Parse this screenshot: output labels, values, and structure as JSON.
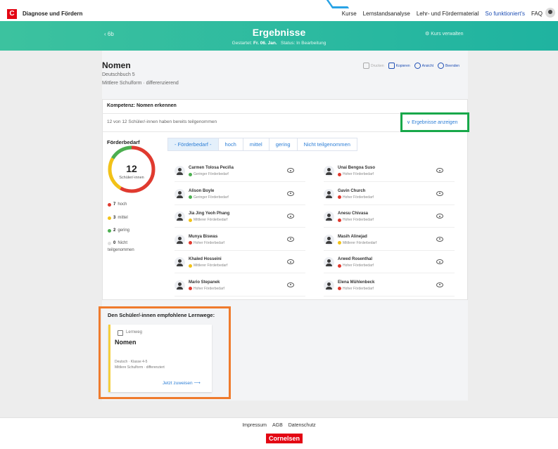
{
  "app": {
    "logo_letter": "C",
    "brand": "Diagnose und Fördern",
    "nav": [
      "Kurse",
      "Lernstandsanalyse",
      "Lehr- und Fördermaterial",
      "So funktioniert's",
      "FAQ"
    ]
  },
  "hero": {
    "back": "6b",
    "title": "Ergebnisse",
    "started_label": "Gestartet:",
    "started_value": "Fr. 06. Jan.",
    "status": "Status: In Bearbeitung",
    "manage": "Kurs verwalten"
  },
  "test": {
    "title": "Nomen",
    "book": "Deutschbuch 5",
    "school": "Mittlere Schulform · differenzierend",
    "actions": [
      "Drucken",
      "Kopieren",
      "Ansicht",
      "Beenden"
    ]
  },
  "competence": {
    "title": "Kompetenz: Nomen erkennen",
    "participation": "12 von 12 Schüler/-innen haben bereits teilgenommen",
    "toggle": "Ergebnisse anzeigen"
  },
  "foerder": {
    "title": "Förderbedarf",
    "count": "12",
    "count_label": "Schüler/-innen",
    "legend": [
      {
        "num": "7",
        "label": "hoch",
        "color": "#e03a2f"
      },
      {
        "num": "3",
        "label": "mittel",
        "color": "#f2c218"
      },
      {
        "num": "2",
        "label": "gering",
        "color": "#4caf50"
      },
      {
        "num": "0",
        "label": "Nicht",
        "label2": "teilgenommen",
        "color": "#e0e0e0"
      }
    ],
    "tabs": [
      "- Förderbedarf -",
      "hoch",
      "mittel",
      "gering",
      "Nicht teilgenommen"
    ]
  },
  "students_left": [
    {
      "name": "Carmen Tolosa Peciña",
      "need": "Geringer Förderbedarf",
      "color": "#4caf50"
    },
    {
      "name": "Alison Boyle",
      "need": "Geringer Förderbedarf",
      "color": "#4caf50"
    },
    {
      "name": "Jia Jing Yeoh Phang",
      "need": "Mittlerer Förderbedarf",
      "color": "#f2c218"
    },
    {
      "name": "Munya Biswas",
      "need": "Hoher Förderbedarf",
      "color": "#e03a2f"
    },
    {
      "name": "Khaled Hosseini",
      "need": "Mittlerer Förderbedarf",
      "color": "#f2c218"
    },
    {
      "name": "Mario Stepanek",
      "need": "Hoher Förderbedarf",
      "color": "#e03a2f"
    }
  ],
  "students_right": [
    {
      "name": "Unai Bengoa Suso",
      "need": "Hoher Förderbedarf",
      "color": "#e03a2f"
    },
    {
      "name": "Gavin Church",
      "need": "Hoher Förderbedarf",
      "color": "#e03a2f"
    },
    {
      "name": "Anesu Chivasa",
      "need": "Hoher Förderbedarf",
      "color": "#e03a2f"
    },
    {
      "name": "Masih Alinejad",
      "need": "Mittlerer Förderbedarf",
      "color": "#f2c218"
    },
    {
      "name": "Arwed Rosenthal",
      "need": "Hoher Förderbedarf",
      "color": "#e03a2f"
    },
    {
      "name": "Elena Mühlenbeck",
      "need": "Hoher Förderbedarf",
      "color": "#e03a2f"
    }
  ],
  "learning": {
    "title": "Den Schüler/-innen empfohlene Lernwege:",
    "tag": "Lernweg",
    "name": "Nomen",
    "detail1": "Deutsch · Klasse 4-5",
    "detail2": "Mittlere Schulform · differenziert",
    "assign": "Jetzt zuweisen"
  },
  "footer": {
    "links": [
      "Impressum",
      "AGB",
      "Datenschutz"
    ],
    "brand": "Cornelsen"
  }
}
